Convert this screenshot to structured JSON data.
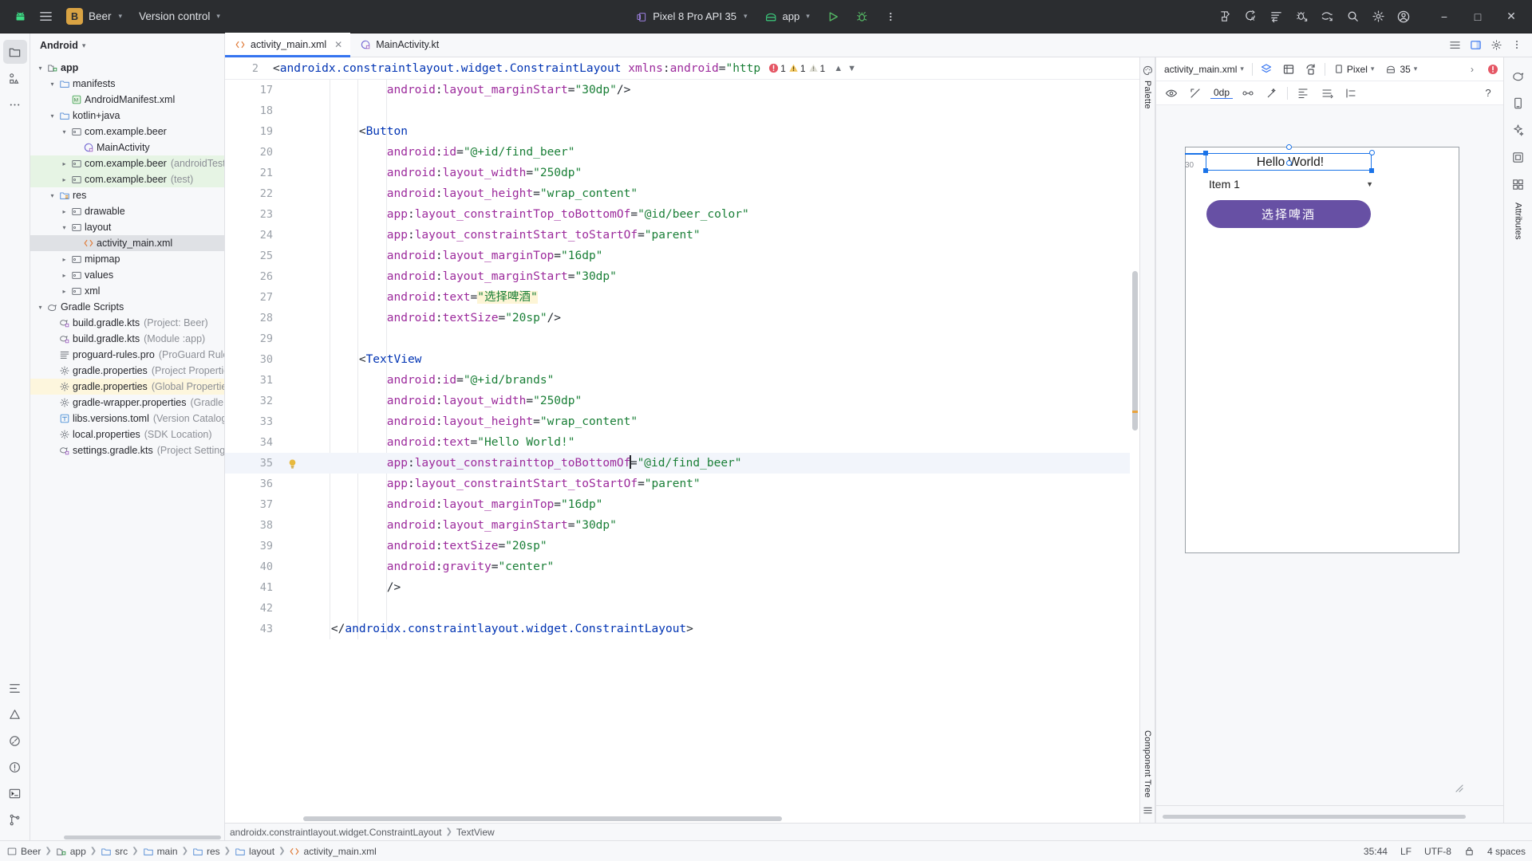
{
  "titlebar": {
    "android_logo": "android-logo-icon",
    "menu_icon": "hamburger-menu-icon",
    "project_badge": "B",
    "project_name": "Beer",
    "vcs_label": "Version control",
    "device_label": "Pixel 8 Pro API 35",
    "run_config_label": "app",
    "run_icon": "run-play-icon",
    "debug_icon": "debug-bug-icon",
    "more_icon": "more-vertical-icon",
    "icons_right": [
      "make-project-icon",
      "code-with-me-icon",
      "gradle-sync-icon",
      "profiler-icon",
      "device-manager-icon",
      "search-icon",
      "settings-gear-icon",
      "account-avatar-icon"
    ],
    "window_minimize": "−",
    "window_maximize": "□",
    "window_close": "✕"
  },
  "left_toolstrip": [
    {
      "name": "project-tool-icon",
      "active": true
    },
    {
      "name": "structure-tool-icon",
      "active": false
    },
    {
      "name": "more-tool-windows-icon",
      "active": false
    }
  ],
  "left_toolstrip_bottom": [
    "terminal-vcs-icon",
    "problems-icon",
    "profiler-icon",
    "notifications-icon",
    "terminal-icon",
    "git-branch-icon"
  ],
  "project_panel": {
    "title": "Android",
    "tree": [
      {
        "depth": 0,
        "arrow": "v",
        "icon": "module-icon",
        "label": "app",
        "sub": "",
        "bold": true,
        "state": ""
      },
      {
        "depth": 1,
        "arrow": "v",
        "icon": "folder-icon",
        "label": "manifests",
        "sub": "",
        "bold": false,
        "state": ""
      },
      {
        "depth": 2,
        "arrow": "",
        "icon": "manifest-file-icon",
        "label": "AndroidManifest.xml",
        "sub": "",
        "bold": false,
        "state": ""
      },
      {
        "depth": 1,
        "arrow": "v",
        "icon": "folder-icon",
        "label": "kotlin+java",
        "sub": "",
        "bold": false,
        "state": ""
      },
      {
        "depth": 2,
        "arrow": "v",
        "icon": "package-icon",
        "label": "com.example.beer",
        "sub": "",
        "bold": false,
        "state": ""
      },
      {
        "depth": 3,
        "arrow": "",
        "icon": "kotlin-class-icon",
        "label": "MainActivity",
        "sub": "",
        "bold": false,
        "state": ""
      },
      {
        "depth": 2,
        "arrow": ">",
        "icon": "package-icon",
        "label": "com.example.beer",
        "sub": "(androidTest)",
        "bold": false,
        "state": "green"
      },
      {
        "depth": 2,
        "arrow": ">",
        "icon": "package-icon",
        "label": "com.example.beer",
        "sub": "(test)",
        "bold": false,
        "state": "green"
      },
      {
        "depth": 1,
        "arrow": "v",
        "icon": "res-folder-icon",
        "label": "res",
        "sub": "",
        "bold": false,
        "state": ""
      },
      {
        "depth": 2,
        "arrow": ">",
        "icon": "package-icon",
        "label": "drawable",
        "sub": "",
        "bold": false,
        "state": ""
      },
      {
        "depth": 2,
        "arrow": "v",
        "icon": "package-icon",
        "label": "layout",
        "sub": "",
        "bold": false,
        "state": ""
      },
      {
        "depth": 3,
        "arrow": "",
        "icon": "xml-file-icon",
        "label": "activity_main.xml",
        "sub": "",
        "bold": false,
        "state": "sel"
      },
      {
        "depth": 2,
        "arrow": ">",
        "icon": "package-icon",
        "label": "mipmap",
        "sub": "",
        "bold": false,
        "state": ""
      },
      {
        "depth": 2,
        "arrow": ">",
        "icon": "package-icon",
        "label": "values",
        "sub": "",
        "bold": false,
        "state": ""
      },
      {
        "depth": 2,
        "arrow": ">",
        "icon": "package-icon",
        "label": "xml",
        "sub": "",
        "bold": false,
        "state": ""
      },
      {
        "depth": 0,
        "arrow": "v",
        "icon": "gradle-icon",
        "label": "Gradle Scripts",
        "sub": "",
        "bold": false,
        "state": ""
      },
      {
        "depth": 1,
        "arrow": "",
        "icon": "gradle-file-icon",
        "label": "build.gradle.kts",
        "sub": "(Project: Beer)",
        "bold": false,
        "state": ""
      },
      {
        "depth": 1,
        "arrow": "",
        "icon": "gradle-file-icon",
        "label": "build.gradle.kts",
        "sub": "(Module :app)",
        "bold": false,
        "state": ""
      },
      {
        "depth": 1,
        "arrow": "",
        "icon": "text-file-icon",
        "label": "proguard-rules.pro",
        "sub": "(ProGuard Rules",
        "bold": false,
        "state": ""
      },
      {
        "depth": 1,
        "arrow": "",
        "icon": "properties-icon",
        "label": "gradle.properties",
        "sub": "(Project Propertie",
        "bold": false,
        "state": ""
      },
      {
        "depth": 1,
        "arrow": "",
        "icon": "properties-icon",
        "label": "gradle.properties",
        "sub": "(Global Properties",
        "bold": false,
        "state": "yellowrow"
      },
      {
        "depth": 1,
        "arrow": "",
        "icon": "properties-icon",
        "label": "gradle-wrapper.properties",
        "sub": "(Gradle …",
        "bold": false,
        "state": ""
      },
      {
        "depth": 1,
        "arrow": "",
        "icon": "toml-file-icon",
        "label": "libs.versions.toml",
        "sub": "(Version Catalog)",
        "bold": false,
        "state": ""
      },
      {
        "depth": 1,
        "arrow": "",
        "icon": "properties-icon",
        "label": "local.properties",
        "sub": "(SDK Location)",
        "bold": false,
        "state": ""
      },
      {
        "depth": 1,
        "arrow": "",
        "icon": "gradle-file-icon",
        "label": "settings.gradle.kts",
        "sub": "(Project Settings",
        "bold": false,
        "state": ""
      }
    ]
  },
  "editor": {
    "tabs": [
      {
        "label": "activity_main.xml",
        "icon": "xml-file-icon",
        "active": true,
        "closable": true
      },
      {
        "label": "MainActivity.kt",
        "icon": "kotlin-class-icon",
        "active": false,
        "closable": false
      }
    ],
    "tab_actions": [
      "split-icon",
      "preview-icon",
      "settings-icon",
      "more-vertical-icon"
    ],
    "sticky_line_number": "2",
    "sticky_code": "<androidx.constraintlayout.widget.ConstraintLayout xmlns:android=\"http",
    "inspections": {
      "error_count": "1",
      "warning_count": "1",
      "weak_warning_count": "1"
    },
    "lines": [
      {
        "num": "17",
        "indent": 3,
        "text": "android:layout_marginStart=\"30dp\"/>"
      },
      {
        "num": "18",
        "indent": 0,
        "text": ""
      },
      {
        "num": "19",
        "indent": 2,
        "text": "<Button"
      },
      {
        "num": "20",
        "indent": 3,
        "text": "android:id=\"@+id/find_beer\""
      },
      {
        "num": "21",
        "indent": 3,
        "text": "android:layout_width=\"250dp\""
      },
      {
        "num": "22",
        "indent": 3,
        "text": "android:layout_height=\"wrap_content\""
      },
      {
        "num": "23",
        "indent": 3,
        "text": "app:layout_constraintTop_toBottomOf=\"@id/beer_color\""
      },
      {
        "num": "24",
        "indent": 3,
        "text": "app:layout_constraintStart_toStartOf=\"parent\""
      },
      {
        "num": "25",
        "indent": 3,
        "text": "android:layout_marginTop=\"16dp\""
      },
      {
        "num": "26",
        "indent": 3,
        "text": "android:layout_marginStart=\"30dp\""
      },
      {
        "num": "27",
        "indent": 3,
        "text": "android:text=\"选择啤酒\""
      },
      {
        "num": "28",
        "indent": 3,
        "text": "android:textSize=\"20sp\"/>"
      },
      {
        "num": "29",
        "indent": 0,
        "text": ""
      },
      {
        "num": "30",
        "indent": 2,
        "text": "<TextView"
      },
      {
        "num": "31",
        "indent": 3,
        "text": "android:id=\"@+id/brands\""
      },
      {
        "num": "32",
        "indent": 3,
        "text": "android:layout_width=\"250dp\""
      },
      {
        "num": "33",
        "indent": 3,
        "text": "android:layout_height=\"wrap_content\""
      },
      {
        "num": "34",
        "indent": 3,
        "text": "android:text=\"Hello World!\""
      },
      {
        "num": "35",
        "indent": 3,
        "text": "app:layout_constrainttop_toBottomOf=\"@id/find_beer\""
      },
      {
        "num": "36",
        "indent": 3,
        "text": "app:layout_constraintStart_toStartOf=\"parent\""
      },
      {
        "num": "37",
        "indent": 3,
        "text": "android:layout_marginTop=\"16dp\""
      },
      {
        "num": "38",
        "indent": 3,
        "text": "android:layout_marginStart=\"30dp\""
      },
      {
        "num": "39",
        "indent": 3,
        "text": "android:textSize=\"20sp\""
      },
      {
        "num": "40",
        "indent": 3,
        "text": "android:gravity=\"center\""
      },
      {
        "num": "41",
        "indent": 3,
        "text": "/>"
      },
      {
        "num": "42",
        "indent": 0,
        "text": ""
      },
      {
        "num": "43",
        "indent": 1,
        "text": "</androidx.constraintlayout.widget.ConstraintLayout>"
      }
    ],
    "highlighted_line": "35",
    "bulb_line": "35",
    "breadcrumbs": [
      "androidx.constraintlayout.widget.ConstraintLayout",
      "TextView"
    ]
  },
  "palette_strip": {
    "label": "Palette",
    "icon": "palette-icon"
  },
  "component_tree_strip": {
    "label": "Component Tree",
    "icon": "component-tree-icon"
  },
  "design": {
    "file_label": "activity_main.xml",
    "toolbar_icons": [
      "design-surface-icon",
      "blueprint-icon",
      "orientation-icon"
    ],
    "theme_label": "Pixel",
    "api_label": "35",
    "nav_next_icon": "chevron-right-icon",
    "error_badge_icon": "error-circle-icon",
    "toolbar2": {
      "visibility_icon": "eye-icon",
      "constraints_icon": "constraints-icon",
      "margin_value": "0dp",
      "chain_icon": "chain-icon",
      "magic_icon": "magic-wand-icon",
      "align_icons": [
        "align-left-icon",
        "align-vertical-icon",
        "guideline-icon"
      ],
      "help_icon": "help-icon"
    },
    "preview": {
      "device_margin_label": "30",
      "textview_text": "Hello World!",
      "spinner_text": "Item 1",
      "button_text": "选择啤酒",
      "button_color": "#6750a4",
      "selection_color": "#1a73e8"
    },
    "zoom_handle_icon": "resize-handle-icon"
  },
  "right_toolstrip": [
    "gradle-elephant-icon",
    "device-manager-icon",
    "assistant-icon",
    "emulator-icon",
    "resource-manager-icon"
  ],
  "right_attributes_label": "Attributes",
  "statusbar": {
    "breadcrumb": [
      {
        "icon": "project-icon",
        "label": "Beer"
      },
      {
        "icon": "module-icon",
        "label": "app"
      },
      {
        "icon": "folder-icon",
        "label": "src"
      },
      {
        "icon": "folder-icon",
        "label": "main"
      },
      {
        "icon": "folder-icon",
        "label": "res"
      },
      {
        "icon": "folder-icon",
        "label": "layout"
      },
      {
        "icon": "xml-file-icon",
        "label": "activity_main.xml"
      }
    ],
    "caret_position": "35:44",
    "line_separator": "LF",
    "encoding": "UTF-8",
    "lock_icon": "lock-icon",
    "indent": "4 spaces"
  },
  "colors": {
    "titlebar_bg": "#2b2d30",
    "panel_bg": "#f7f8fa",
    "editor_bg": "#ffffff",
    "accent_blue": "#3574f0",
    "tag_blue": "#0033b3",
    "attr_purple": "#9c2a9c",
    "string_green": "#1a7f37",
    "selection_green": "#e6f4e4"
  }
}
